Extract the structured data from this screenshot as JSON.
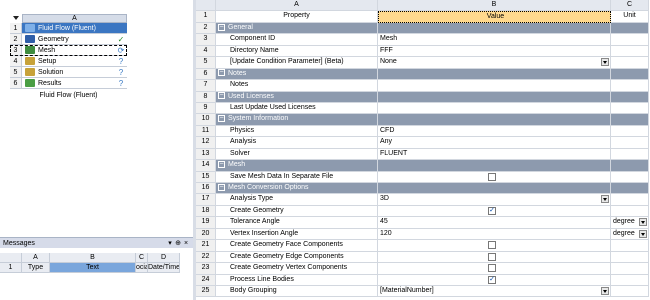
{
  "schematic": {
    "column_letter": "A",
    "rows": [
      {
        "num": "1",
        "label": "Fluid Flow (Fluent)",
        "icon": "fluent-icon",
        "icon_color": "#7fb0e8",
        "status": ""
      },
      {
        "num": "2",
        "label": "Geometry",
        "icon": "geometry-icon",
        "icon_color": "#2f5ea8",
        "status": "✓"
      },
      {
        "num": "3",
        "label": "Mesh",
        "icon": "mesh-icon",
        "icon_color": "#3f8c3f",
        "status": "⟳"
      },
      {
        "num": "4",
        "label": "Setup",
        "icon": "setup-icon",
        "icon_color": "#c7a23a",
        "status": "?"
      },
      {
        "num": "5",
        "label": "Solution",
        "icon": "solution-icon",
        "icon_color": "#c7a23a",
        "status": "?"
      },
      {
        "num": "6",
        "label": "Results",
        "icon": "results-icon",
        "icon_color": "#4a9e44",
        "status": "?"
      }
    ],
    "caption": "Fluid Flow (Fluent)"
  },
  "messages": {
    "title": "Messages",
    "controls": [
      "▾",
      "⊕",
      "×"
    ],
    "columns": [
      "",
      "A",
      "B",
      "C",
      "D"
    ],
    "row": [
      "1",
      "Type",
      "Text",
      "ociat",
      "Date/Time"
    ]
  },
  "properties": {
    "columns": [
      "",
      "A",
      "B",
      "C"
    ],
    "header": {
      "num": "1",
      "property": "Property",
      "value": "Value",
      "unit": "Unit"
    },
    "rows": [
      {
        "num": "2",
        "type": "section",
        "property": "General"
      },
      {
        "num": "3",
        "type": "text",
        "property": "Component ID",
        "value": "Mesh"
      },
      {
        "num": "4",
        "type": "text",
        "property": "Directory Name",
        "value": "FFF"
      },
      {
        "num": "5",
        "type": "dropdown",
        "property": "[Update Condition Parameter] (Beta)",
        "value": "None"
      },
      {
        "num": "6",
        "type": "section",
        "property": "Notes"
      },
      {
        "num": "7",
        "type": "text",
        "property": "Notes",
        "value": ""
      },
      {
        "num": "8",
        "type": "section",
        "property": "Used Licenses"
      },
      {
        "num": "9",
        "type": "text",
        "property": "Last Update Used Licenses",
        "value": ""
      },
      {
        "num": "10",
        "type": "section",
        "property": "System Information"
      },
      {
        "num": "11",
        "type": "text",
        "property": "Physics",
        "value": "CFD"
      },
      {
        "num": "12",
        "type": "text",
        "property": "Analysis",
        "value": "Any"
      },
      {
        "num": "13",
        "type": "text",
        "property": "Solver",
        "value": "FLUENT"
      },
      {
        "num": "14",
        "type": "section",
        "property": "Mesh"
      },
      {
        "num": "15",
        "type": "checkbox",
        "property": "Save Mesh Data In Separate File",
        "checked": false
      },
      {
        "num": "16",
        "type": "section",
        "property": "Mesh Conversion Options"
      },
      {
        "num": "17",
        "type": "dropdown",
        "property": "Analysis Type",
        "value": "3D"
      },
      {
        "num": "18",
        "type": "checkbox",
        "property": "Create Geometry",
        "checked": true
      },
      {
        "num": "19",
        "type": "text",
        "property": "Tolerance Angle",
        "value": "45",
        "unit": "degree"
      },
      {
        "num": "20",
        "type": "text",
        "property": "Vertex Insertion Angle",
        "value": "120",
        "unit": "degree"
      },
      {
        "num": "21",
        "type": "checkbox",
        "property": "Create Geometry Face Components",
        "checked": false
      },
      {
        "num": "22",
        "type": "checkbox",
        "property": "Create Geometry Edge Components",
        "checked": false
      },
      {
        "num": "23",
        "type": "checkbox",
        "property": "Create Geometry Vertex Components",
        "checked": false
      },
      {
        "num": "24",
        "type": "checkbox",
        "property": "Process Line Bodies",
        "checked": true
      },
      {
        "num": "25",
        "type": "dropdown",
        "property": "Body Grouping",
        "value": "[MaterialNumber]"
      }
    ]
  }
}
